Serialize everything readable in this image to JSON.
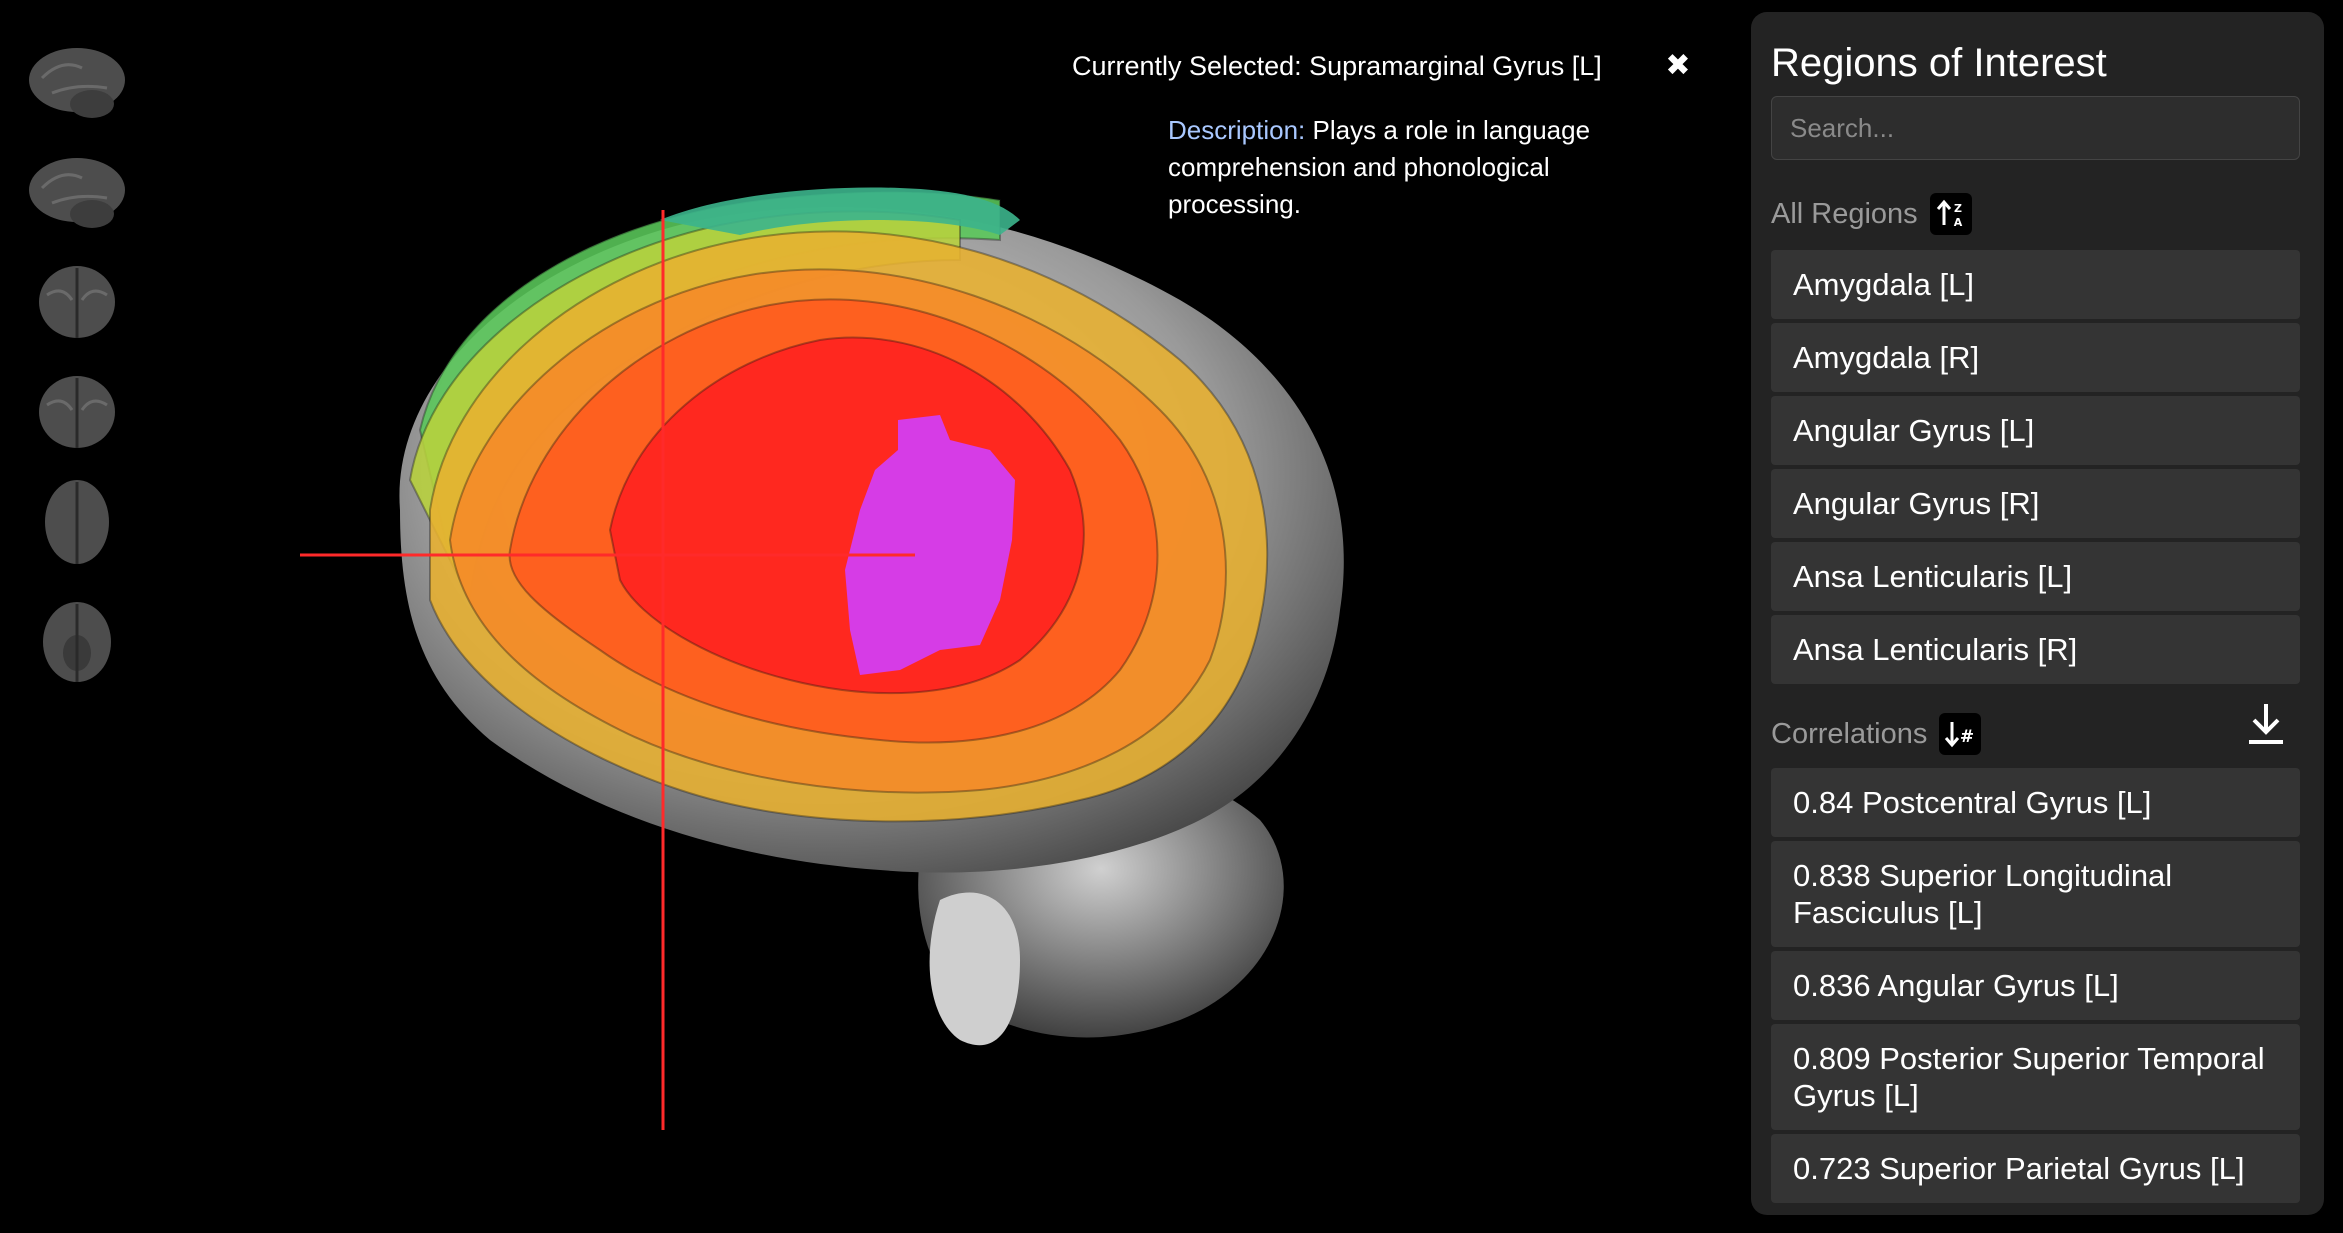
{
  "header": {
    "selected_label": "Currently Selected:",
    "selected_value": "Supramarginal Gyrus [L]",
    "close_symbol": "✖"
  },
  "description": {
    "label": "Description:",
    "text": "Plays a role in language comprehension and phonological processing."
  },
  "thumbnails": [
    {
      "view": "left-lateral-view-icon"
    },
    {
      "view": "right-lateral-view-icon"
    },
    {
      "view": "anterior-view-icon"
    },
    {
      "view": "posterior-view-icon"
    },
    {
      "view": "superior-view-icon"
    },
    {
      "view": "inferior-view-icon"
    }
  ],
  "viewport": {
    "highlight_color": "#d63ce6",
    "crosshair_color": "#ff2a2a",
    "heat_colors": [
      "#ff2020",
      "#ff5a1e",
      "#f58a28",
      "#e8b030",
      "#b8d23c",
      "#5ac85a",
      "#3cb48c"
    ]
  },
  "panel": {
    "title": "Regions of Interest",
    "search_placeholder": "Search...",
    "regions_heading": "All Regions",
    "regions": [
      "Amygdala [L]",
      "Amygdala [R]",
      "Angular Gyrus [L]",
      "Angular Gyrus [R]",
      "Ansa Lenticularis [L]",
      "Ansa Lenticularis [R]"
    ],
    "correlations_heading": "Correlations",
    "correlations": [
      {
        "value": "0.84",
        "region": "Postcentral Gyrus [L]"
      },
      {
        "value": "0.838",
        "region": "Superior Longitudinal Fasciculus [L]"
      },
      {
        "value": "0.836",
        "region": "Angular Gyrus [L]"
      },
      {
        "value": "0.809",
        "region": "Posterior Superior Temporal Gyrus [L]"
      },
      {
        "value": "0.723",
        "region": "Superior Parietal Gyrus [L]"
      }
    ]
  }
}
